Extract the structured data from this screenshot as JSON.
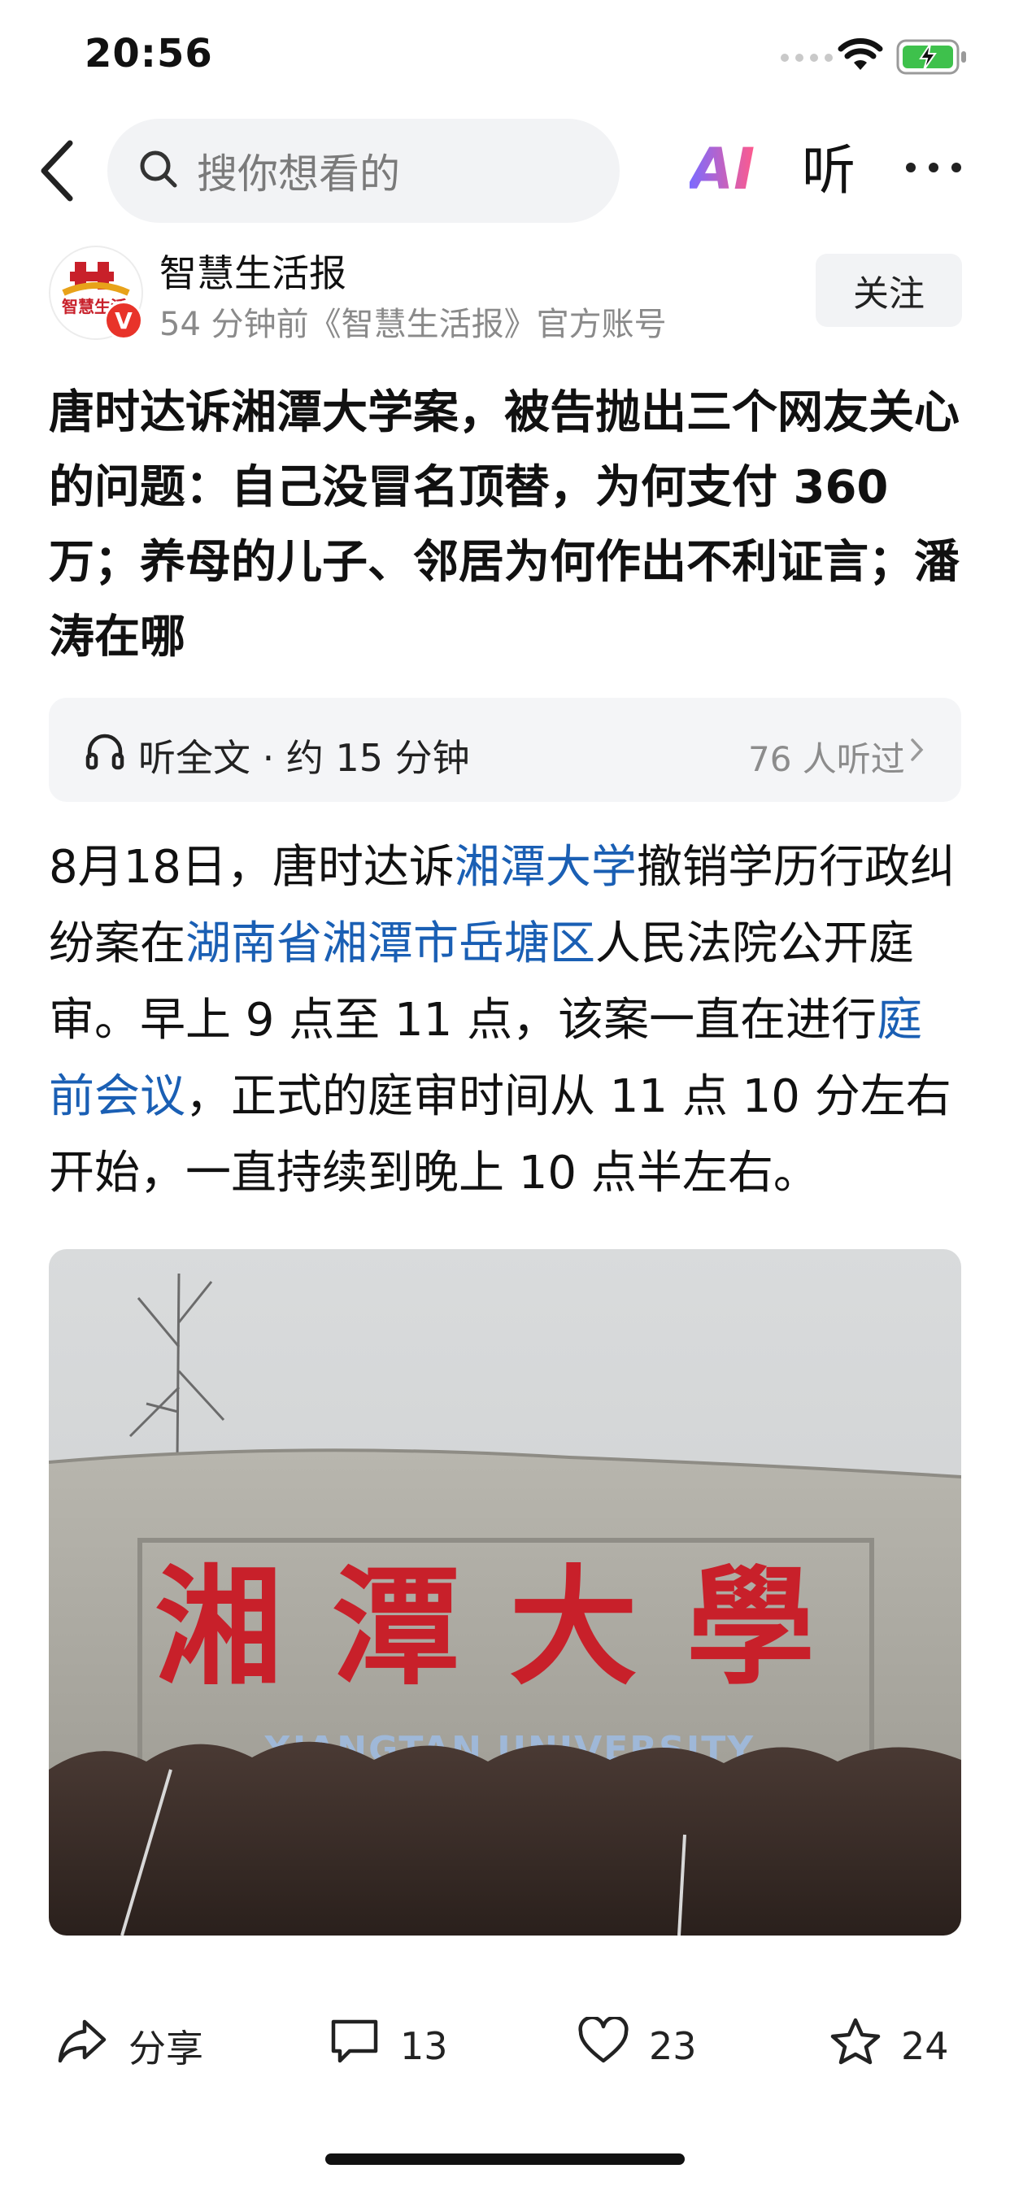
{
  "status_bar": {
    "time": "20:56"
  },
  "nav": {
    "search_placeholder": "搜你想看的",
    "ai_label": "AI",
    "listen_label": "听"
  },
  "author": {
    "name": "智慧生活报",
    "meta": "54 分钟前《智慧生活报》官方账号",
    "avatar_text": "智慧生活",
    "badge": "V",
    "follow_label": "关注"
  },
  "article": {
    "title": "唐时达诉湘潭大学案，被告抛出三个网友关心的问题：自己没冒名顶替，为何支付 360 万；养母的儿子、邻居为何作出不利证言；潘涛在哪",
    "listen_card": {
      "label": "听全文 · 约 15 分钟",
      "count": "76 人听过"
    },
    "body": {
      "p1": "8月18日，唐时达诉",
      "l1": "湘潭大学",
      "p2": "撤销学历行政纠纷案在",
      "l2": "湖南省湘潭市岳塘区",
      "p3": "人民法院公开庭审。早上 9 点至 11 点，该案一直在进行",
      "l3": "庭前会议",
      "p4": "，正式的庭审时间从 11 点 10 分左右开始，一直持续到晚上 10 点半左右。"
    },
    "photo": {
      "sign_cn": "湘潭大學",
      "sign_en": "XIANGTAN UNIVERSITY"
    }
  },
  "bottom_bar": {
    "share_label": "分享",
    "comments": "13",
    "likes": "23",
    "favorites": "24"
  },
  "colors": {
    "link": "#1a5fb4",
    "badge": "#e8332a",
    "sign_red": "#c8202a"
  }
}
